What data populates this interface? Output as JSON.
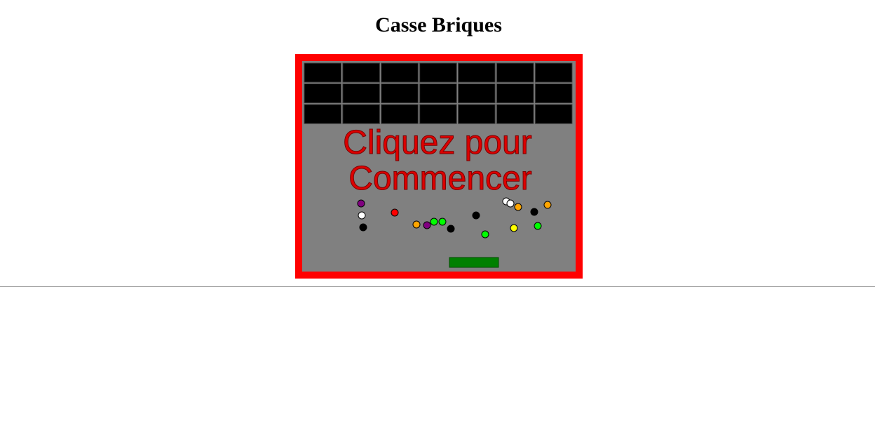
{
  "page": {
    "title": "Casse Briques"
  },
  "game": {
    "start_message_line1": "Cliquez pour",
    "start_message_line2": "Commencer",
    "brick_rows": 3,
    "brick_cols": 7,
    "colors": {
      "frame": "#ff0000",
      "playfield": "#808080",
      "brick": "#000000",
      "paddle": "#008000",
      "message": "#dd0000"
    },
    "balls": [
      {
        "color": "purple"
      },
      {
        "color": "white"
      },
      {
        "color": "black"
      },
      {
        "color": "red"
      },
      {
        "color": "orange"
      },
      {
        "color": "purple"
      },
      {
        "color": "lime"
      },
      {
        "color": "lime"
      },
      {
        "color": "black"
      },
      {
        "color": "black"
      },
      {
        "color": "lime"
      },
      {
        "color": "white"
      },
      {
        "color": "white"
      },
      {
        "color": "orange"
      },
      {
        "color": "yellow"
      },
      {
        "color": "black"
      },
      {
        "color": "lime"
      },
      {
        "color": "orange"
      }
    ]
  }
}
